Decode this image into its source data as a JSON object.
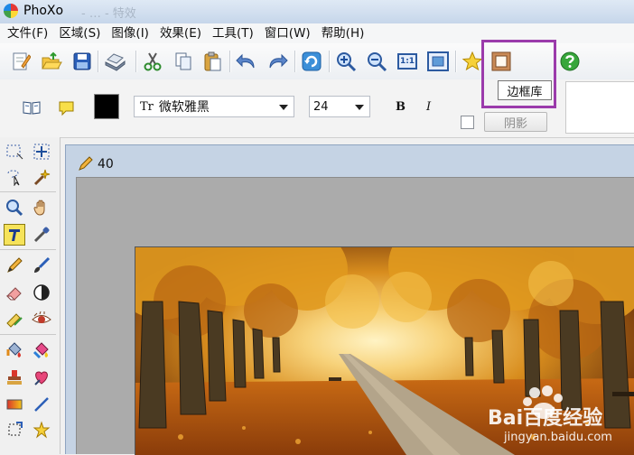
{
  "window": {
    "title": "PhoXo",
    "faint_title": "- … - 特效"
  },
  "menu": [
    "文件(F)",
    "区域(S)",
    "图像(I)",
    "效果(E)",
    "工具(T)",
    "窗口(W)",
    "帮助(H)"
  ],
  "toolbar": {
    "icons": [
      "new-icon",
      "open-icon",
      "save-icon",
      "print-icon",
      "cut-icon",
      "copy-icon",
      "paste-icon",
      "undo-icon",
      "redo-icon",
      "refresh-icon",
      "zoom-in-icon",
      "zoom-out-icon",
      "actual-size-icon",
      "fit-window-icon",
      "favorites-icon",
      "frame-library-icon",
      "help-icon"
    ],
    "actual_size_label": "1:1",
    "tooltip": "边框库"
  },
  "text_options": {
    "font": "微软雅黑",
    "font_prefix": "Tr",
    "size": "24",
    "bold_label": "B",
    "italic_label": "I",
    "shadow_label": "阴影",
    "color": "#000000"
  },
  "document": {
    "title": "40"
  },
  "watermark": {
    "brand": "Bai百度经验",
    "url": "jingyan.baidu.com"
  },
  "colors": {
    "highlight": "#9b3bab",
    "titlebar": "#c6d6ea",
    "doc_frame": "#c5d3e4"
  }
}
